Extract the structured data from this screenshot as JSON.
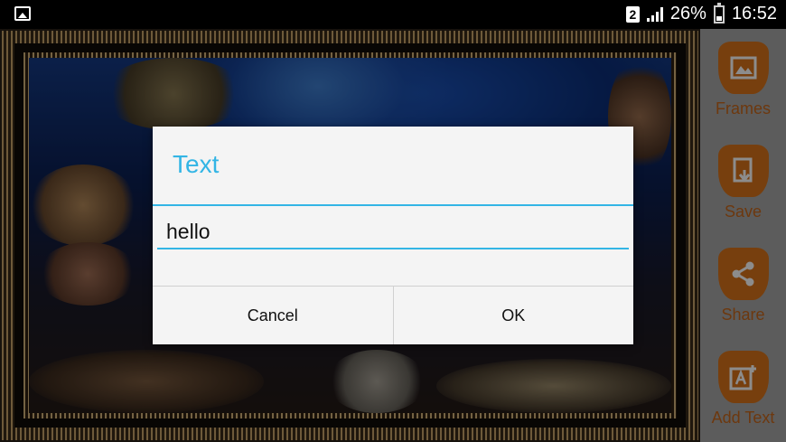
{
  "status_bar": {
    "sim_slot": "2",
    "battery": "26%",
    "time": "16:52"
  },
  "sidebar": {
    "items": [
      {
        "label": "Frames",
        "icon": "frames-icon"
      },
      {
        "label": "Save",
        "icon": "save-icon"
      },
      {
        "label": "Share",
        "icon": "share-icon"
      },
      {
        "label": "Add Text",
        "icon": "add-text-icon"
      }
    ],
    "accent_color": "#d9731a"
  },
  "dialog": {
    "title": "Text",
    "input_value": "hello",
    "cancel_label": "Cancel",
    "ok_label": "OK",
    "accent_color": "#33b5e5"
  }
}
